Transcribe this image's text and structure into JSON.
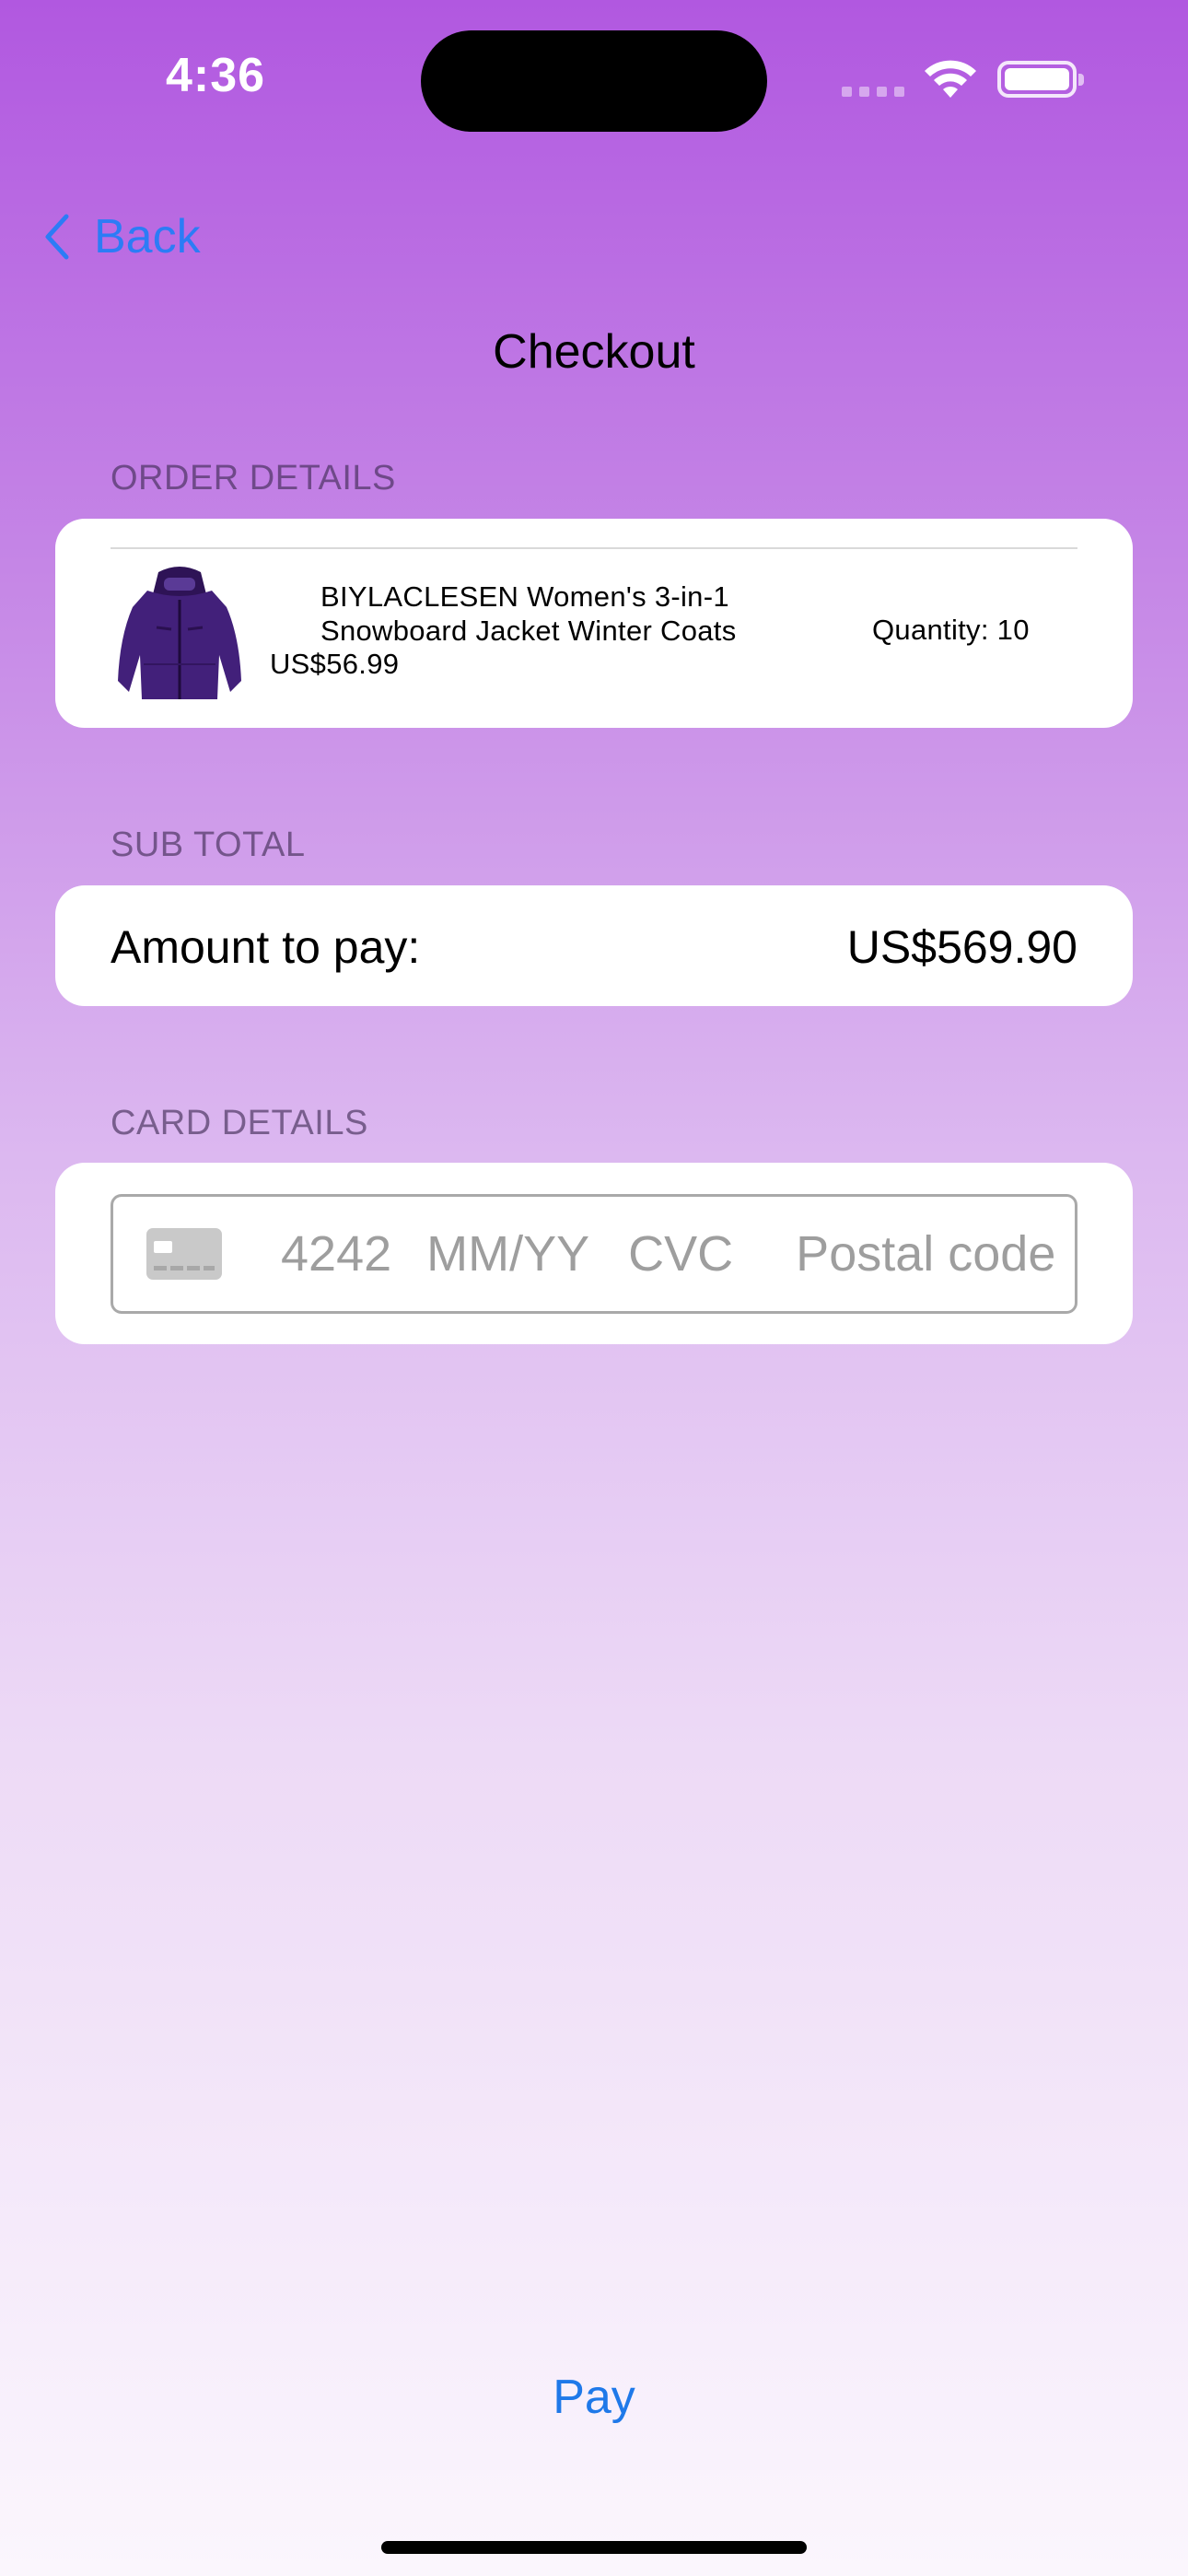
{
  "status_bar": {
    "time": "4:36"
  },
  "nav": {
    "back_label": "Back",
    "title": "Checkout"
  },
  "sections": {
    "order_details": "ORDER DETAILS",
    "sub_total": "SUB TOTAL",
    "card_details": "CARD DETAILS"
  },
  "order": {
    "items": [
      {
        "name": "BIYLACLESEN Women's 3-in-1 Snowboard Jacket Winter Coats",
        "price": "US$56.99",
        "quantity": "Quantity: 10",
        "image_icon": "purple-jacket-image"
      }
    ]
  },
  "subtotal": {
    "label": "Amount to pay:",
    "value": "US$569.90"
  },
  "card_input": {
    "number_placeholder": "4242",
    "expiry_placeholder": "MM/YY",
    "cvc_placeholder": "CVC",
    "postal_placeholder": "Postal code",
    "card_icon": "credit-card-icon"
  },
  "actions": {
    "pay_label": "Pay"
  },
  "colors": {
    "accent": "#2c7cf6",
    "gradient_top": "#b158e0",
    "gradient_bottom": "#fbf6fd",
    "jacket": "#3d1a6e"
  }
}
